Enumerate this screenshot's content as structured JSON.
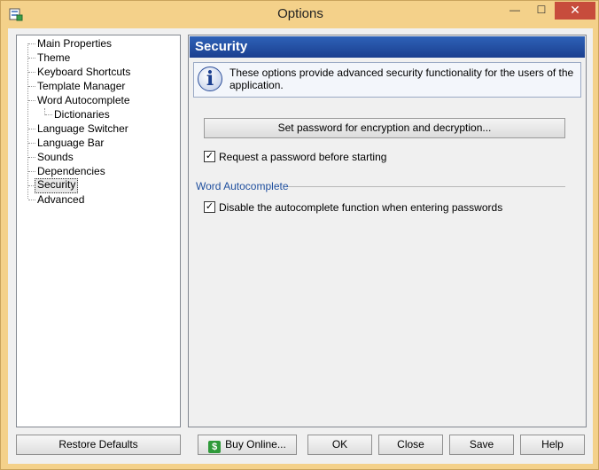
{
  "window": {
    "title": "Options",
    "controls": {
      "minimize": "—",
      "maximize": "☐",
      "close": "✕"
    }
  },
  "sidebar": {
    "items": [
      {
        "label": "Main Properties",
        "level": 0
      },
      {
        "label": "Theme",
        "level": 0
      },
      {
        "label": "Keyboard Shortcuts",
        "level": 0
      },
      {
        "label": "Template Manager",
        "level": 0
      },
      {
        "label": "Word Autocomplete",
        "level": 0
      },
      {
        "label": "Dictionaries",
        "level": 1
      },
      {
        "label": "Language Switcher",
        "level": 0
      },
      {
        "label": "Language Bar",
        "level": 0
      },
      {
        "label": "Sounds",
        "level": 0
      },
      {
        "label": "Dependencies",
        "level": 0
      },
      {
        "label": "Security",
        "level": 0,
        "selected": true
      },
      {
        "label": "Advanced",
        "level": 0
      }
    ]
  },
  "panel": {
    "title": "Security",
    "info_icon": "info-icon",
    "info_text": "These options provide advanced security functionality for the users of the application.",
    "set_password_button": "Set password for encryption and decryption...",
    "request_password": {
      "label": "Request a password before starting",
      "checked": true
    },
    "group_word_autocomplete": "Word Autocomplete",
    "disable_autocomplete": {
      "label": "Disable the autocomplete function when entering passwords",
      "checked": true
    }
  },
  "footer": {
    "restore_defaults": "Restore Defaults",
    "buy_online": "Buy Online...",
    "ok": "OK",
    "close": "Close",
    "save": "Save",
    "help": "Help"
  },
  "colors": {
    "title_bar": "#f4d18a",
    "panel_header": "#1f4f9e",
    "close_button": "#c74c3c"
  }
}
